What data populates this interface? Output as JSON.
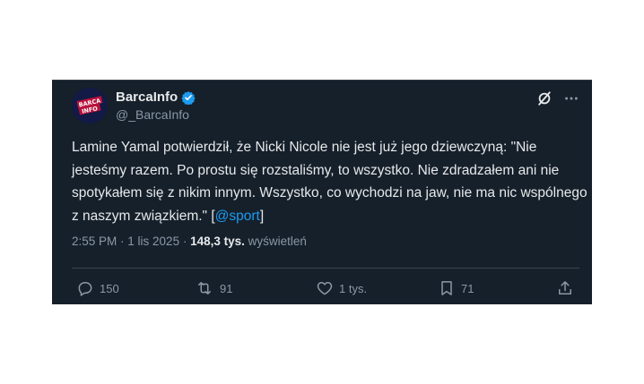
{
  "account": {
    "display_name": "BarcaInfo",
    "handle": "@_BarcaInfo",
    "avatar_text_line1": "BARCA",
    "avatar_text_line2": "INFO"
  },
  "tweet": {
    "text_part1": "Lamine Yamal potwierdził, że Nicki Nicole nie jest już jego dziewczyną: \"Nie jesteśmy razem. Po prostu się rozstaliśmy, to wszystko. Nie zdradzałem ani nie spotykałem się z nikim innym. Wszystko, co wychodzi na jaw, nie ma nic wspólnego z naszym związkiem.\" [",
    "mention": "@sport",
    "text_part2": "]"
  },
  "meta": {
    "time": "2:55 PM",
    "separator1": " · ",
    "date": "1 lis 2025",
    "separator2": " · ",
    "views_count": "148,3 tys.",
    "views_label": " wyświetleń"
  },
  "actions": {
    "replies": "150",
    "reposts": "91",
    "likes": "1 tys.",
    "bookmarks": "71"
  },
  "colors": {
    "background": "#15202b",
    "text": "#e7e9ea",
    "secondary": "#8b98a5",
    "accent": "#1d9bf0"
  },
  "icons": [
    "verified-badge-icon",
    "grok-icon",
    "more-icon",
    "reply-icon",
    "repost-icon",
    "like-icon",
    "bookmark-icon",
    "share-icon"
  ]
}
